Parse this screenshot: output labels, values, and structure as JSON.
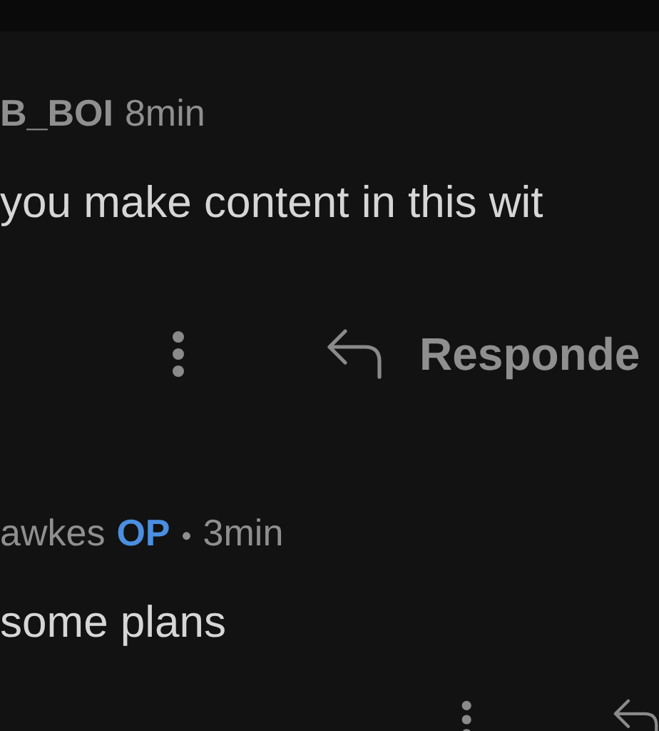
{
  "comments": [
    {
      "author": "B_BOI",
      "time": "8min",
      "body": "you make content in this wit",
      "reply_label": "Responde"
    },
    {
      "author": "awkes",
      "op_label": "OP",
      "separator": "•",
      "time": "3min",
      "body": "some plans"
    }
  ]
}
